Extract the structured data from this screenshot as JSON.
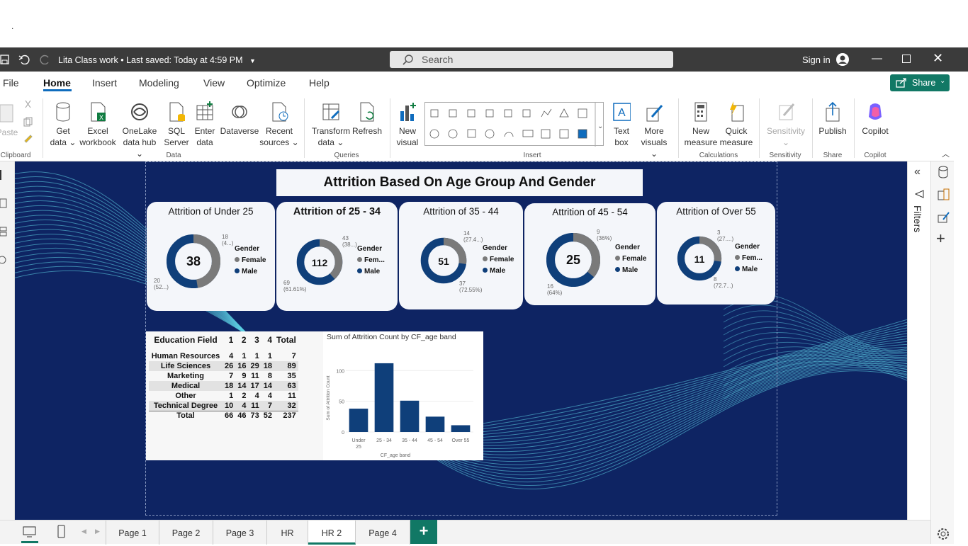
{
  "window": {
    "title": "Lita Class work",
    "saved_status": "Last saved: Today at 4:59 PM",
    "search_placeholder": "Search",
    "sign_in": "Sign in",
    "top_dot": "."
  },
  "ribbon_tabs": [
    "File",
    "Home",
    "Insert",
    "Modeling",
    "View",
    "Optimize",
    "Help"
  ],
  "share_label": "Share",
  "ribbon": {
    "clipboard": {
      "paste": "Paste",
      "group": "Clipboard"
    },
    "data": {
      "get_data": [
        "Get",
        "data"
      ],
      "excel": [
        "Excel",
        "workbook"
      ],
      "onelake": [
        "OneLake",
        "data hub"
      ],
      "sql": [
        "SQL",
        "Server"
      ],
      "enter": [
        "Enter",
        "data"
      ],
      "dataverse": "Dataverse",
      "recent": [
        "Recent",
        "sources"
      ],
      "group": "Data"
    },
    "queries": {
      "transform": [
        "Transform",
        "data"
      ],
      "refresh": "Refresh",
      "group": "Queries"
    },
    "insert": {
      "new_visual": [
        "New",
        "visual"
      ],
      "text_box": [
        "Text",
        "box"
      ],
      "more_visuals": [
        "More",
        "visuals"
      ],
      "group": "Insert"
    },
    "calculations": {
      "new_measure": [
        "New",
        "measure"
      ],
      "quick_measure": [
        "Quick",
        "measure"
      ],
      "group": "Calculations"
    },
    "sensitivity": {
      "label": "Sensitivity",
      "group": "Sensitivity"
    },
    "share": {
      "publish": "Publish",
      "group": "Share"
    },
    "copilot": {
      "label": "Copilot",
      "group": "Copilot"
    }
  },
  "filters_label": "Filters",
  "report": {
    "title": "Attrition Based On Age Group And Gender",
    "legend_title": "Gender",
    "cards": [
      {
        "title": "Attrition of Under 25",
        "total": "38",
        "female": 18,
        "male": 20,
        "female_label": "18",
        "female_pct": "(4...)",
        "male_label": "20",
        "male_pct": "(52...)",
        "legend_female": "Female",
        "legend_male": "Male"
      },
      {
        "title": "Attrition of 25 - 34",
        "total": "112",
        "female": 43,
        "male": 69,
        "female_label": "43",
        "female_pct": "(38...)",
        "male_label": "69",
        "male_pct": "(61.61%)",
        "legend_female": "Fem...",
        "legend_male": "Male"
      },
      {
        "title": "Attrition of 35 - 44",
        "total": "51",
        "female": 14,
        "male": 37,
        "female_label": "14",
        "female_pct": "(27.4...)",
        "male_label": "37",
        "male_pct": "(72.55%)",
        "legend_female": "Female",
        "legend_male": "Male"
      },
      {
        "title": "Attrition of 45 - 54",
        "total": "25",
        "female": 9,
        "male": 16,
        "female_label": "9",
        "female_pct": "(36%)",
        "male_label": "16",
        "male_pct": "(64%)",
        "legend_female": "Female",
        "legend_male": "Male"
      },
      {
        "title": "Attrition of Over 55",
        "total": "11",
        "female": 3,
        "male": 8,
        "female_label": "3",
        "female_pct": "(27....)",
        "male_label": "8",
        "male_pct": "(72.7...)",
        "legend_female": "Fem...",
        "legend_male": "Male"
      }
    ],
    "matrix": {
      "headers": [
        "Education Field",
        "1",
        "2",
        "3",
        "4",
        "Total"
      ],
      "rows": [
        [
          "Human Resources",
          "4",
          "1",
          "1",
          "1",
          "7"
        ],
        [
          "Life Sciences",
          "26",
          "16",
          "29",
          "18",
          "89"
        ],
        [
          "Marketing",
          "7",
          "9",
          "11",
          "8",
          "35"
        ],
        [
          "Medical",
          "18",
          "14",
          "17",
          "14",
          "63"
        ],
        [
          "Other",
          "1",
          "2",
          "4",
          "4",
          "11"
        ],
        [
          "Technical Degree",
          "10",
          "4",
          "11",
          "7",
          "32"
        ],
        [
          "Total",
          "66",
          "46",
          "73",
          "52",
          "237"
        ]
      ]
    },
    "colors": {
      "male": "#0f3f7a",
      "female": "#7a7a7a",
      "canvas": "#0e2463",
      "accent": "#117865"
    }
  },
  "chart_data": {
    "type": "bar",
    "title": "Sum of Attrition Count by CF_age band",
    "xlabel": "CF_age band",
    "ylabel": "Sum of Attrition Count",
    "categories": [
      "Under 25",
      "25 - 34",
      "35 - 44",
      "45 - 54",
      "Over 55"
    ],
    "values": [
      38,
      112,
      51,
      25,
      11
    ],
    "yticks": [
      "0",
      "50",
      "100"
    ],
    "ylim": [
      0,
      120
    ]
  },
  "page_tabs": [
    "Page 1",
    "Page 2",
    "Page 3",
    "HR",
    "HR 2",
    "Page 4"
  ],
  "active_page": "HR 2",
  "add_page": "+"
}
